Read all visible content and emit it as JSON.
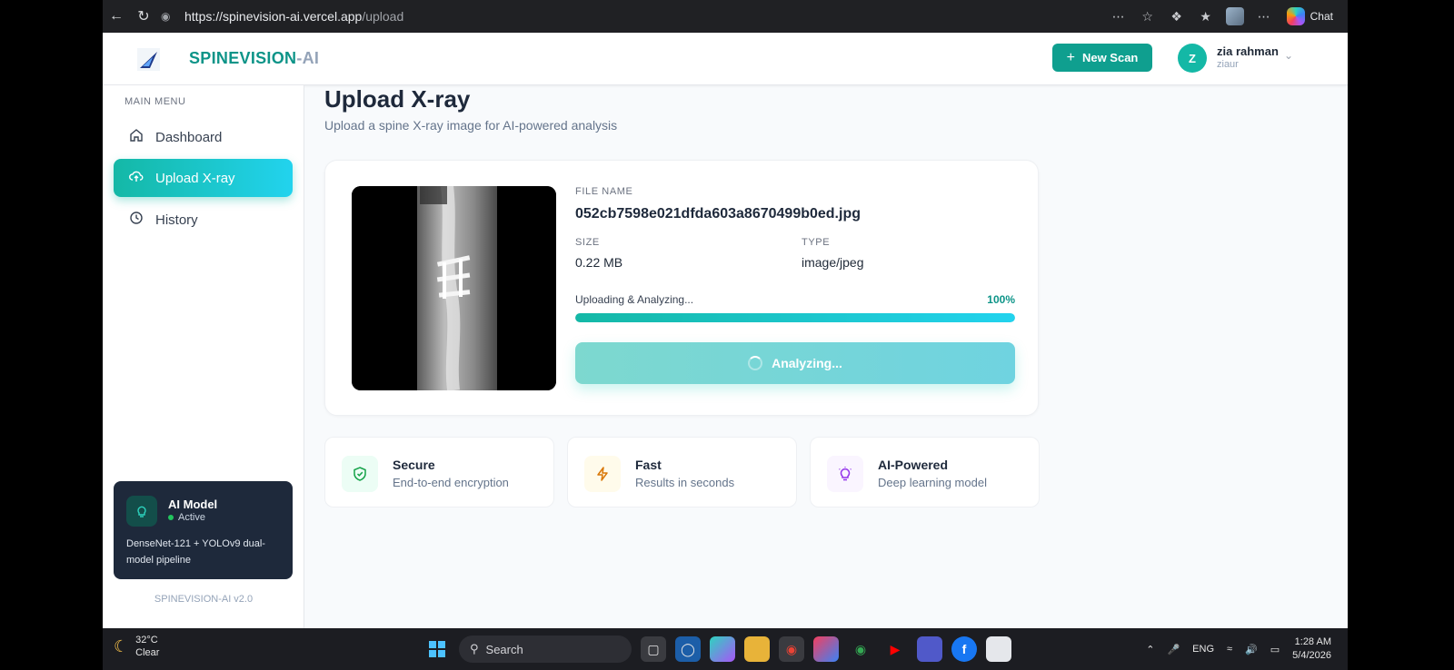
{
  "browser": {
    "url_host": "https://spinevision-ai.vercel.app",
    "url_path": "/upload",
    "chat_label": "Chat"
  },
  "topbar": {
    "brand_part1": "SPINEVISION",
    "brand_part2": "-AI",
    "new_scan_label": "New Scan",
    "user_initial": "Z",
    "user_name": "zia rahman",
    "user_handle": "ziaur"
  },
  "sidebar": {
    "menu_label": "MAIN MENU",
    "items": [
      {
        "label": "Dashboard",
        "icon": "home-icon"
      },
      {
        "label": "Upload X-ray",
        "icon": "upload-cloud-icon"
      },
      {
        "label": "History",
        "icon": "clock-icon"
      }
    ],
    "ai_card": {
      "title": "AI Model",
      "status": "Active",
      "description": "DenseNet-121 + YOLOv9 dual-model pipeline"
    },
    "version": "SPINEVISION-AI v2.0"
  },
  "main": {
    "title": "Upload X-ray",
    "subtitle": "Upload a spine X-ray image for AI-powered analysis",
    "file": {
      "name_label": "FILE NAME",
      "name": "052cb7598e021dfda603a8670499b0ed.jpg",
      "size_label": "SIZE",
      "size": "0.22 MB",
      "type_label": "TYPE",
      "type": "image/jpeg"
    },
    "progress": {
      "label": "Uploading & Analyzing...",
      "percent_text": "100%",
      "value": 100
    },
    "analyze_button": "Analyzing...",
    "features": [
      {
        "title": "Secure",
        "desc": "End-to-end encryption",
        "icon": "shield-check-icon",
        "color": "#16a34a"
      },
      {
        "title": "Fast",
        "desc": "Results in seconds",
        "icon": "lightning-icon",
        "color": "#d97706"
      },
      {
        "title": "AI-Powered",
        "desc": "Deep learning model",
        "icon": "lightbulb-icon",
        "color": "#9333ea"
      }
    ]
  },
  "taskbar": {
    "temp": "32°C",
    "weather": "Clear",
    "search": "Search",
    "lang": "ENG",
    "time": "1:28 AM",
    "date": "5/4/2026"
  }
}
